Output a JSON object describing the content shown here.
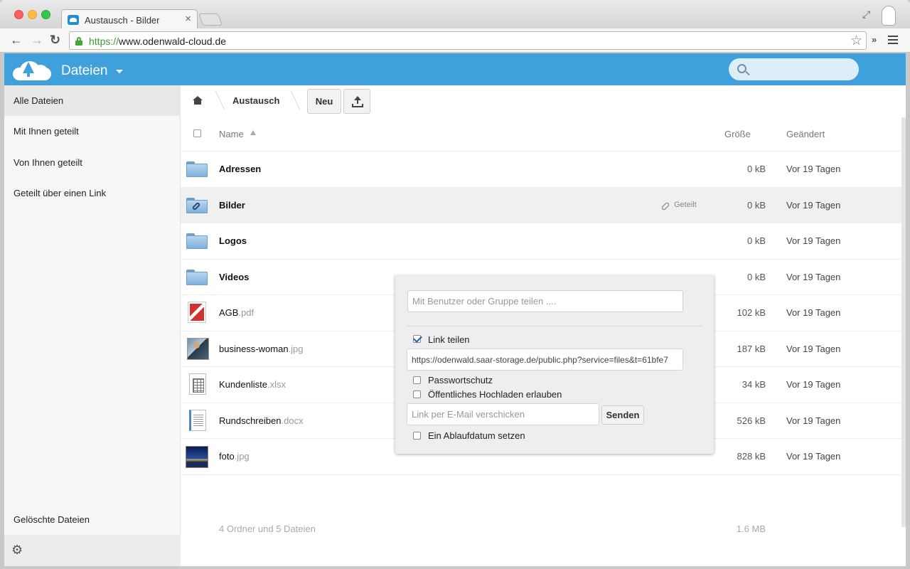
{
  "browser": {
    "tab_title": "Austausch - Bilder",
    "tab_close": "×",
    "url_scheme": "https://",
    "url_rest": "www.odenwald-cloud.de",
    "back": "←",
    "forward": "→",
    "reload": "↻",
    "star": "☆",
    "extensions": "»",
    "fullscreen": "⤢"
  },
  "header": {
    "app_title": "Dateien",
    "search_value": ""
  },
  "sidebar": {
    "items": [
      {
        "label": "Alle Dateien",
        "active": true
      },
      {
        "label": "Mit Ihnen geteilt"
      },
      {
        "label": "Von Ihnen geteilt"
      },
      {
        "label": "Geteilt über einen Link"
      }
    ],
    "deleted": "Gelöschte Dateien",
    "settings_icon": "⚙"
  },
  "controls": {
    "breadcrumb": "Austausch",
    "new_button": "Neu"
  },
  "table": {
    "headers": {
      "name": "Name",
      "size": "Größe",
      "modified": "Geändert"
    },
    "rows": [
      {
        "name": "Adressen",
        "ext": "",
        "size": "0 kB",
        "modified": "Vor 19 Tagen",
        "type": "folder"
      },
      {
        "name": "Bilder",
        "ext": "",
        "size": "0 kB",
        "modified": "Vor 19 Tagen",
        "type": "folder-shared",
        "shared_label": "Geteilt"
      },
      {
        "name": "Logos",
        "ext": "",
        "size": "0 kB",
        "modified": "Vor 19 Tagen",
        "type": "folder"
      },
      {
        "name": "Videos",
        "ext": "",
        "size": "0 kB",
        "modified": "Vor 19 Tagen",
        "type": "folder"
      },
      {
        "name": "AGB",
        "ext": ".pdf",
        "size": "102 kB",
        "modified": "Vor 19 Tagen",
        "type": "pdf"
      },
      {
        "name": "business-woman",
        "ext": ".jpg",
        "size": "187 kB",
        "modified": "Vor 19 Tagen",
        "type": "image"
      },
      {
        "name": "Kundenliste",
        "ext": ".xlsx",
        "size": "34 kB",
        "modified": "Vor 19 Tagen",
        "type": "spreadsheet"
      },
      {
        "name": "Rundschreiben",
        "ext": ".docx",
        "size": "526 kB",
        "modified": "Vor 19 Tagen",
        "type": "document"
      },
      {
        "name": "foto",
        "ext": ".jpg",
        "size": "828 kB",
        "modified": "Vor 19 Tagen",
        "type": "image"
      }
    ],
    "summary": {
      "text": "4 Ordner und 5 Dateien",
      "size": "1.6 MB"
    }
  },
  "share_dropdown": {
    "share_placeholder": "Mit Benutzer oder Gruppe teilen ....",
    "link_share_label": "Link teilen",
    "link_share_checked": true,
    "link_url": "https://odenwald.saar-storage.de/public.php?service=files&t=61bfe7",
    "password_label": "Passwortschutz",
    "password_checked": false,
    "public_upload_label": "Öffentliches Hochladen erlauben",
    "public_upload_checked": false,
    "email_placeholder": "Link per E-Mail verschicken",
    "send_button": "Senden",
    "expiry_label": "Ein Ablaufdatum setzen",
    "expiry_checked": false
  }
}
